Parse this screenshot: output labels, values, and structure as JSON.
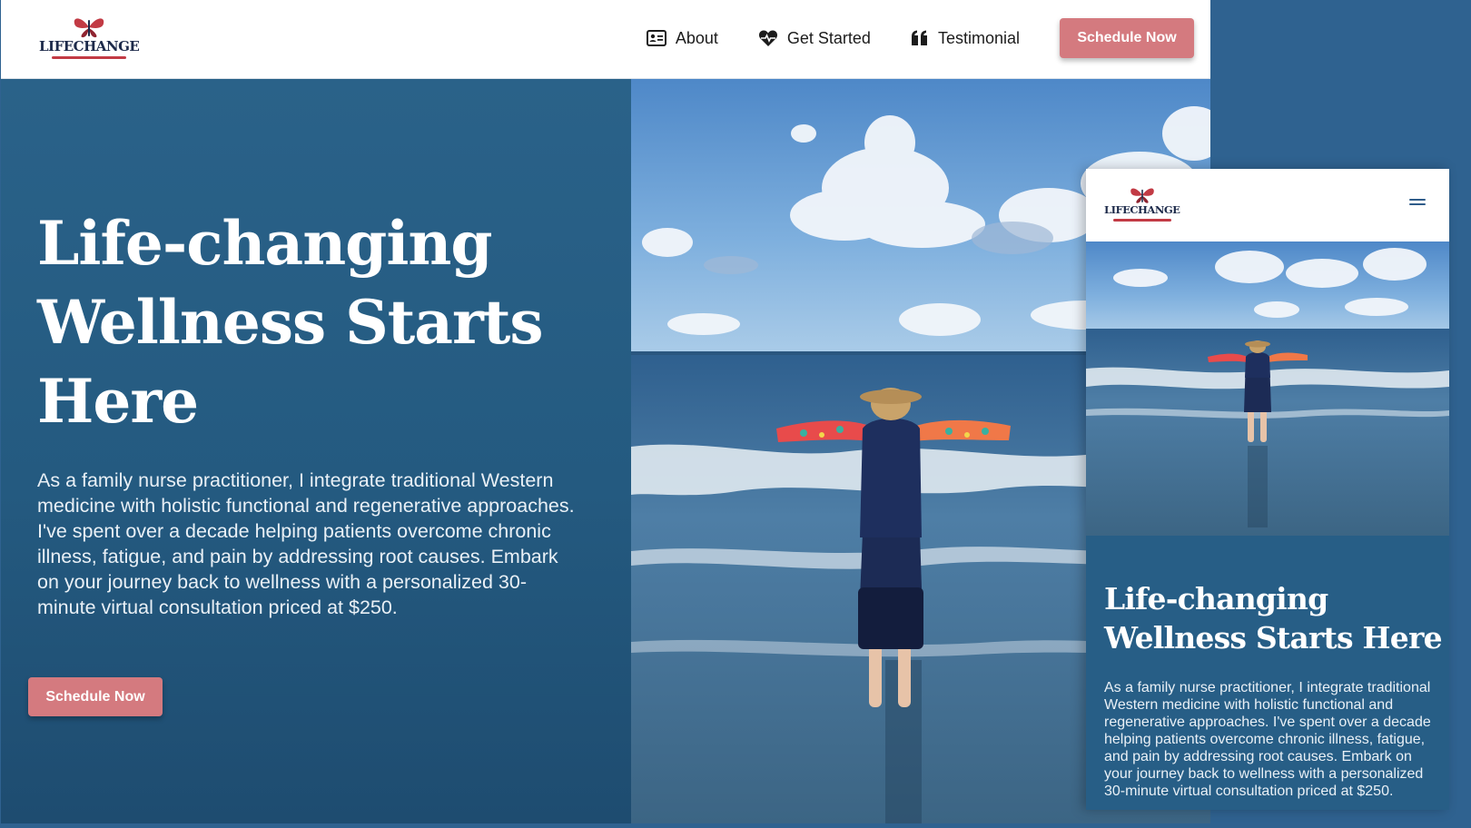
{
  "brand": {
    "logo_text": "LIFECHANGE"
  },
  "nav": {
    "items": [
      {
        "label": "About",
        "icon": "id-card-icon"
      },
      {
        "label": "Get Started",
        "icon": "heart-pulse-icon"
      },
      {
        "label": "Testimonial",
        "icon": "quote-icon"
      }
    ],
    "cta_label": "Schedule Now"
  },
  "hero": {
    "title": "Life-changing Wellness Starts Here",
    "body": "As a family nurse practitioner, I integrate traditional Western medicine with holistic functional and regenerative approaches. I've spent over a decade helping patients overcome chronic illness, fatigue, and pain by addressing root causes. Embark on your journey back to wellness with a personalized 30-minute virtual consultation priced at $250.",
    "cta_label": "Schedule Now"
  },
  "mobile": {
    "logo_text": "LIFECHANGE",
    "menu_icon": "hamburger-menu-icon",
    "title": "Life-changing Wellness Starts Here",
    "body": "As a family nurse practitioner, I integrate traditional Western medicine with holistic functional and regenerative approaches. I've spent over a decade helping patients overcome chronic illness, fatigue, and pain by addressing root causes. Embark on your journey back to wellness with a personalized 30-minute virtual consultation priced at $250."
  },
  "colors": {
    "hero_blue": "#235b82",
    "cta_pink": "#d47a7f",
    "logo_red": "#c23a44",
    "logo_navy": "#1d2a4a"
  }
}
